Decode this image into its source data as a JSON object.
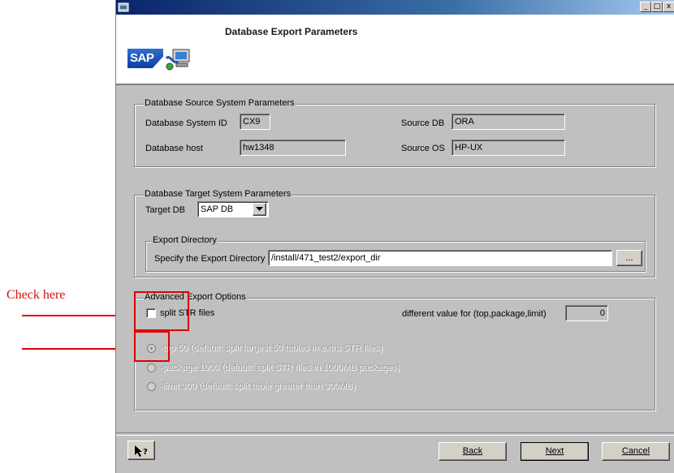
{
  "window": {
    "title": "Database Export Parameters",
    "logo_text": "SAP",
    "controls": [
      "_",
      "□",
      "x"
    ]
  },
  "annotations": {
    "check_here": "Check here"
  },
  "source_group": {
    "legend": "Database Source System Parameters",
    "system_id_label": "Database System ID",
    "system_id_value": "CX9",
    "host_label": "Database host",
    "host_value": "hw1348",
    "source_db_label": "Source DB",
    "source_db_value": "ORA",
    "source_os_label": "Source OS",
    "source_os_value": "HP-UX"
  },
  "target_group": {
    "legend": "Database Target System Parameters",
    "target_db_label": "Target DB",
    "target_db_value": "SAP DB",
    "export_dir_legend": "Export Directory",
    "export_dir_label": "Specify the Export Directory",
    "export_dir_value": "/install/471_test2/export_dir",
    "browse_label": "..."
  },
  "advanced_group": {
    "legend": "Advanced Export Options",
    "split_label": "split STR files",
    "split_checked": false,
    "different_value_label": "different value for (top,package,limit)",
    "different_value": "0",
    "options": [
      {
        "label": "-top 50 (default: split largest 50 tables in extra STR files)",
        "selected": true
      },
      {
        "label": "-package 1000 (default: split STR files in 1000MB packages)",
        "selected": false
      },
      {
        "label": "-limit 300 (default: split table greater than 300MB)",
        "selected": false
      }
    ]
  },
  "footer": {
    "help_icon": "help-pointer-icon",
    "back_label": "Back",
    "next_label": "Next",
    "cancel_label": "Cancel"
  },
  "colors": {
    "annotation_red": "#e00000",
    "dialog_gray": "#c0c0c0",
    "titlebar_blue": "#0a246a"
  }
}
